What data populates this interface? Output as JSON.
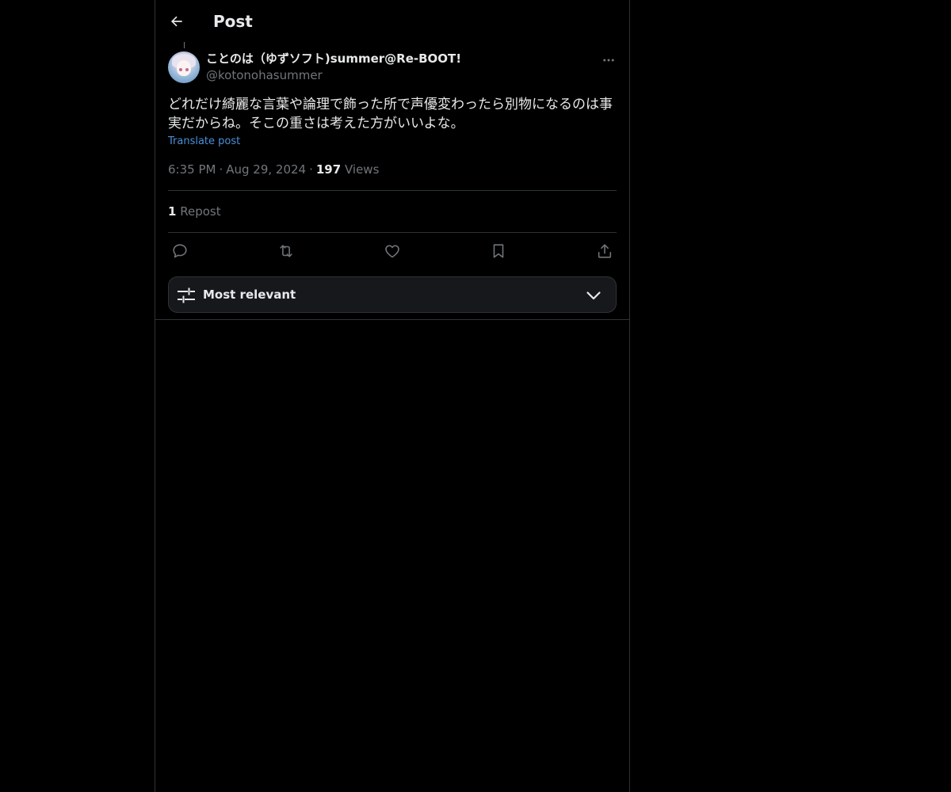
{
  "header": {
    "title": "Post"
  },
  "post": {
    "display_name": "ことのは（ゆずソフト)summer@Re-BOOT!",
    "handle": "@kotonohasummer",
    "text": "どれだけ綺麗な言葉や論理で飾った所で声優変わったら別物になるのは事実だからね。そこの重さは考えた方がいいよな。",
    "translate_label": "Translate post",
    "time": "6:35 PM",
    "date": "Aug 29, 2024",
    "separator": "·",
    "views_count": "197",
    "views_label": "Views",
    "repost_count": "1",
    "repost_label": "Repost"
  },
  "sort": {
    "label": "Most relevant"
  },
  "icons": {
    "back": "arrow-left-icon",
    "more": "ellipsis-icon",
    "reply": "speech-bubble-icon",
    "repost": "repost-arrows-icon",
    "like": "heart-icon",
    "bookmark": "bookmark-icon",
    "share": "share-upload-icon",
    "sort": "sliders-icon",
    "chevron": "chevron-down-icon"
  },
  "colors": {
    "background": "#000000",
    "text_primary": "#e7e9ea",
    "text_secondary": "#71767b",
    "link": "#4a90d9",
    "border": "#2f3336"
  }
}
